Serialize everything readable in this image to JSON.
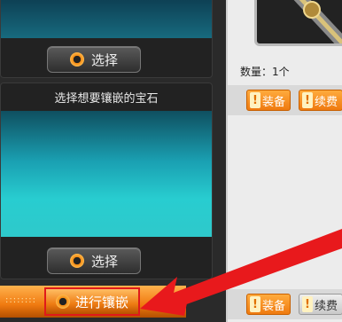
{
  "top_panel": {
    "select_label": "选择"
  },
  "gem_panel": {
    "title": "选择想要镶嵌的宝石",
    "select_label": "选择"
  },
  "action": {
    "inlay_label": "进行镶嵌",
    "dots": "::::::::"
  },
  "item_info": {
    "quantity": "数量：1个"
  },
  "buttons_top": {
    "equip": "装备",
    "renew": "续费"
  },
  "buttons_bottom": {
    "equip": "装备",
    "renew": "续费"
  },
  "icons": {
    "button_icon": "ring-icon",
    "notice_icon": "exclamation-icon",
    "item": "sword-handle"
  },
  "colors": {
    "accent": "#f07a10",
    "highlight": "#e01a1a",
    "gem_bg": "#28cdd0"
  }
}
